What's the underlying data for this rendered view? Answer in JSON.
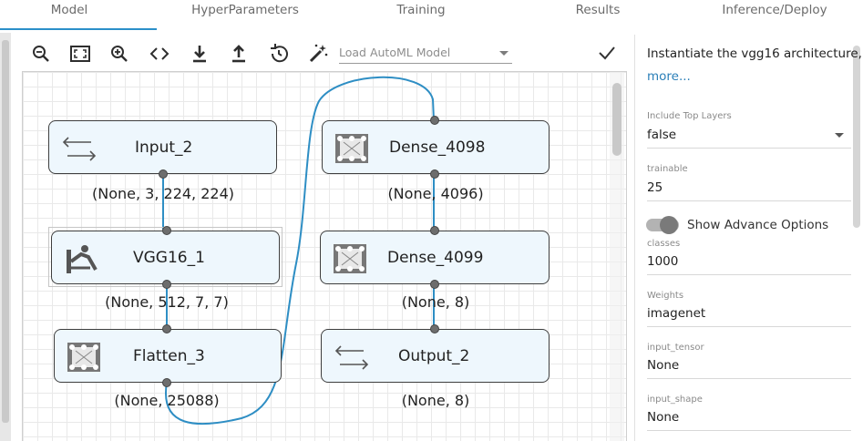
{
  "tabs": [
    {
      "label": "Model",
      "active": true
    },
    {
      "label": "HyperParameters",
      "active": false
    },
    {
      "label": "Training",
      "active": false
    },
    {
      "label": "Results",
      "active": false
    },
    {
      "label": "Inference/Deploy",
      "active": false
    }
  ],
  "toolbar": {
    "icons": [
      "zoom-out-icon",
      "fit-screen-icon",
      "zoom-in-icon",
      "code-icon",
      "download-icon",
      "upload-icon",
      "history-icon",
      "magic-wand-icon"
    ],
    "automl_placeholder": "Load AutoML Model",
    "confirm_icon": "checkmark-icon"
  },
  "nodes": {
    "input_2": {
      "label": "Input_2",
      "shape": "(None, 3, 224, 224)",
      "icon": "swap-arrows-icon"
    },
    "vgg16_1": {
      "label": "VGG16_1",
      "shape": "(None, 512, 7, 7)",
      "icon": "vgg-person-icon"
    },
    "flatten_3": {
      "label": "Flatten_3",
      "shape": "(None, 25088)",
      "icon": "layer-block-icon"
    },
    "dense_4098": {
      "label": "Dense_4098",
      "shape": "(None, 4096)",
      "icon": "layer-block-icon"
    },
    "dense_4099": {
      "label": "Dense_4099",
      "shape": "(None, 8)",
      "icon": "layer-block-icon"
    },
    "output_2": {
      "label": "Output_2",
      "shape": "(None, 8)",
      "icon": "swap-arrows-icon"
    }
  },
  "panel": {
    "description": "Instantiate the vgg16 architecture,",
    "more": "more...",
    "include_top": {
      "label": "Include Top Layers",
      "value": "false"
    },
    "trainable": {
      "label": "trainable",
      "value": "25"
    },
    "advance_toggle": {
      "label": "Show Advance Options",
      "on": true
    },
    "classes": {
      "label": "classes",
      "value": "1000"
    },
    "weights": {
      "label": "Weights",
      "value": "imagenet"
    },
    "input_tensor": {
      "label": "input_tensor",
      "value": "None"
    },
    "input_shape": {
      "label": "input_shape",
      "value": "None"
    }
  },
  "colors": {
    "accent": "#2b8fc9",
    "node_fill": "#eef7fd",
    "link": "#2e8ec4",
    "more_link": "#2b7fb8"
  }
}
